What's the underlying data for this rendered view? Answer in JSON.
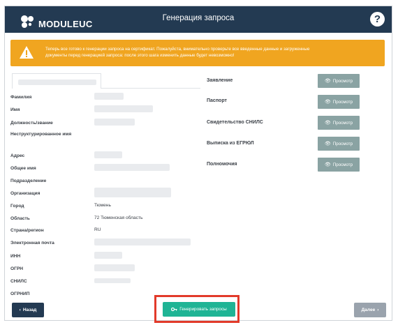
{
  "header": {
    "logo_text": "MODULEUC",
    "title": "Генерация запроса",
    "help_icon": "question-circle-icon",
    "help_label": "?",
    "background": "#233a52"
  },
  "warning": {
    "icon": "warning-triangle-icon",
    "line1": "Теперь все готово к генерации запроса на сертификат. Пожалуйста, внимательно проверьте все введенные данные и загруженные",
    "line2": "документы перед генерацией запроса: после этого шага изменить данные будет невозможно!",
    "background": "#f0a520"
  },
  "fields": [
    {
      "label": "Фамилия",
      "value": ""
    },
    {
      "label": "Имя",
      "value": ""
    },
    {
      "label": "Должность/звание",
      "value": ""
    },
    {
      "label": "Неструктурированное имя",
      "value": ""
    },
    {
      "label": "Адрес",
      "value": ""
    },
    {
      "label": "Общее имя",
      "value": ""
    },
    {
      "label": "Подразделение",
      "value": ""
    },
    {
      "label": "Организация",
      "value": ""
    },
    {
      "label": "Город",
      "value": "Тюмень"
    },
    {
      "label": "Область",
      "value": "72 Тюменская область"
    },
    {
      "label": "Страна/регион",
      "value": "RU"
    },
    {
      "label": "Электронная почта",
      "value": ""
    },
    {
      "label": "ИНН",
      "value": ""
    },
    {
      "label": "ОГРН",
      "value": ""
    },
    {
      "label": "СНИЛС",
      "value": ""
    },
    {
      "label": "ОГРНИП",
      "value": ""
    }
  ],
  "documents": [
    {
      "label": "Заявление",
      "button": "Просмотр"
    },
    {
      "label": "Паспорт",
      "button": "Просмотр"
    },
    {
      "label": "Свидетельство СНИЛС",
      "button": "Просмотр"
    },
    {
      "label": "Выписка из ЕГРЮЛ",
      "button": "Просмотр"
    },
    {
      "label": "Полномочия",
      "button": "Просмотр"
    }
  ],
  "footer": {
    "back_label": "Назад",
    "back_icon": "chevron-left-icon",
    "generate_label": "Генерировать запросы",
    "generate_icon": "key-icon",
    "next_label": "Далее",
    "next_icon": "chevron-right-icon",
    "generate_color": "#1fb495",
    "highlight_color": "#e23a2a"
  }
}
